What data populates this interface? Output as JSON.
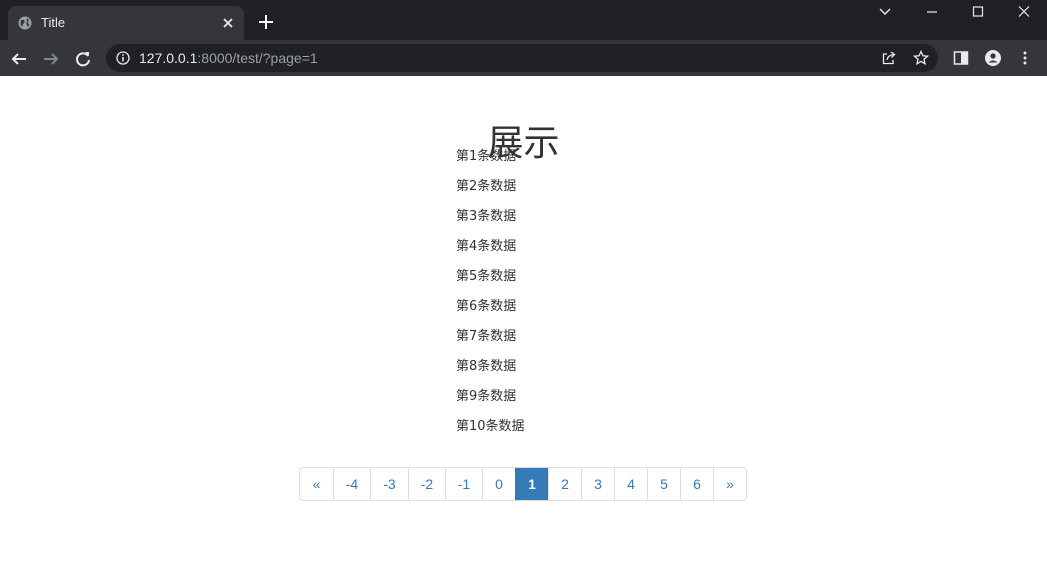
{
  "browser": {
    "tab": {
      "title": "Title"
    },
    "address_bar": {
      "host": "127.0.0.1",
      "rest": ":8000/test/?page=1"
    }
  },
  "page": {
    "title": "展示",
    "items": [
      "第1条数据",
      "第2条数据",
      "第3条数据",
      "第4条数据",
      "第5条数据",
      "第6条数据",
      "第7条数据",
      "第8条数据",
      "第9条数据",
      "第10条数据"
    ],
    "pagination": {
      "prev_label": "«",
      "next_label": "»",
      "pages": [
        "-4",
        "-3",
        "-2",
        "-1",
        "0",
        "1",
        "2",
        "3",
        "4",
        "5",
        "6"
      ],
      "current": "1"
    }
  },
  "colors": {
    "accent": "#337ab7",
    "chrome_dark": "#202124",
    "chrome_toolbar": "#35363a"
  }
}
